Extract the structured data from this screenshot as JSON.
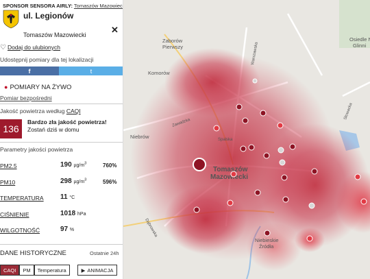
{
  "sponsor": {
    "label": "SPONSOR SENSORA AIRLY:",
    "link": "Tomaszów Mazowiecki"
  },
  "station": {
    "street": "ul. Legionów",
    "city": "Tomaszów Mazowiecki"
  },
  "favorite_label": "Dodaj do ulubionych",
  "share_label": "Udostępnij pomiary dla tej lokalizacji",
  "social": {
    "facebook": "f",
    "twitter": "t"
  },
  "live": {
    "title": "POMIARY NA ŻYWO",
    "direct_link": "Pomiar bezpośredni"
  },
  "quality": {
    "label_prefix": "Jakość powietrza według",
    "label_link": "CAQI",
    "index": "136",
    "verdict": "Bardzo zła jakość powietrza!",
    "advice": "Zostań dziś w domu",
    "index_color": "#9e1a2c"
  },
  "params": {
    "title": "Parametry jakości powietrza",
    "pm25": {
      "name": "PM2.5",
      "value": "190",
      "unit": "µg/m",
      "sup": "3",
      "pct": "760%"
    },
    "pm10": {
      "name": "PM10",
      "value": "298",
      "unit": "µg/m",
      "sup": "3",
      "pct": "596%"
    },
    "temperature": {
      "name": "TEMPERATURA",
      "value": "11",
      "unit": "°C"
    },
    "pressure": {
      "name": "CIŚNIENIE",
      "value": "1018",
      "unit": "hPa"
    },
    "humidity": {
      "name": "WILGOTNOŚĆ",
      "value": "97",
      "unit": "%"
    }
  },
  "history": {
    "title": "DANE HISTORYCZNE",
    "period": "Ostatnie 24h"
  },
  "buttons": {
    "caqi": "CAQI",
    "pm": "PM",
    "temperature": "Temperatura",
    "animation": "ANIMACJA"
  },
  "map": {
    "labels": {
      "city": "Tomaszów",
      "city2": "Mazowiecki",
      "zaborow": "Zaborów",
      "pierwszy": "Pierwszy",
      "komorow": "Komorów",
      "niebrow": "Niebrów",
      "osiedle": "Osiedle N",
      "glinnik": "Glinni",
      "niebieskie": "Niebieskie",
      "zrodla": "Źródła",
      "warszawska": "Warszawska",
      "zawadzka": "Zawadzka",
      "spalska": "Spalska",
      "dabrowska": "Dąbrowska",
      "slowacka": "Słowacka"
    }
  }
}
